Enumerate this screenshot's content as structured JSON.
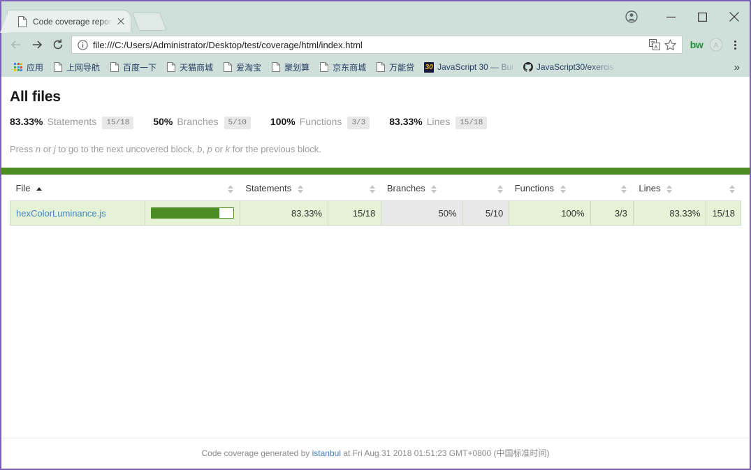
{
  "browser": {
    "tab": {
      "title": "Code coverage report f",
      "favicon": "document-icon",
      "close_label": "×"
    },
    "new_tab_label": "+",
    "window_controls": {
      "profile": "account-icon",
      "minimize": "—",
      "maximize": "▢",
      "close": "✕"
    },
    "nav": {
      "back": "←",
      "forward": "→",
      "reload": "⟳"
    },
    "omnibox": {
      "url": "file:///C:/Users/Administrator/Desktop/test/coverage/html/index.html",
      "info_icon": "info-circle-icon",
      "translate_icon": "translate-icon",
      "bookmark_icon": "star-icon"
    },
    "extensions": [
      {
        "name": "bw-extension",
        "label": "bw"
      },
      {
        "name": "angular-extension",
        "label": "A"
      }
    ],
    "menu_label": "⋮",
    "bookmarks": [
      {
        "name": "apps",
        "label": "应用",
        "icon": "apps-grid-icon"
      },
      {
        "name": "shangwang-daohang",
        "label": "上网导航",
        "icon": "page-icon"
      },
      {
        "name": "baidu",
        "label": "百度一下",
        "icon": "page-icon"
      },
      {
        "name": "tmall",
        "label": "天猫商城",
        "icon": "page-icon"
      },
      {
        "name": "aitaobao",
        "label": "爱淘宝",
        "icon": "page-icon"
      },
      {
        "name": "juhuasuan",
        "label": "聚划算",
        "icon": "page-icon"
      },
      {
        "name": "jingdong",
        "label": "京东商城",
        "icon": "page-icon"
      },
      {
        "name": "wannengdai",
        "label": "万能贷",
        "icon": "page-icon"
      },
      {
        "name": "javascript30",
        "label": "JavaScript 30 — Bui",
        "icon": "badge-30-icon"
      },
      {
        "name": "javascript30-github",
        "label": "JavaScript30/exercis",
        "icon": "github-icon"
      }
    ],
    "bookmarks_overflow": "»"
  },
  "report": {
    "title": "All files",
    "summary": [
      {
        "pct": "83.33%",
        "metric": "Statements",
        "fraction": "15/18"
      },
      {
        "pct": "50%",
        "metric": "Branches",
        "fraction": "5/10"
      },
      {
        "pct": "100%",
        "metric": "Functions",
        "fraction": "3/3"
      },
      {
        "pct": "83.33%",
        "metric": "Lines",
        "fraction": "15/18"
      }
    ],
    "hint": {
      "p1": "Press ",
      "k1": "n",
      "p2": " or ",
      "k2": "j",
      "p3": " to go to the next uncovered block, ",
      "k3": "b",
      "p4": ", ",
      "k4": "p",
      "p5": " or ",
      "k5": "k",
      "p6": " for the previous block."
    },
    "table": {
      "headers": {
        "file": "File",
        "statements": "Statements",
        "branches": "Branches",
        "functions": "Functions",
        "lines": "Lines"
      },
      "sort": {
        "column": "File",
        "direction": "asc"
      },
      "rows": [
        {
          "file": "hexColorLuminance.js",
          "bar_pct": 83.33,
          "statements_pct": "83.33%",
          "statements_frac": "15/18",
          "statements_level": "high",
          "branches_pct": "50%",
          "branches_frac": "5/10",
          "branches_level": "medium",
          "functions_pct": "100%",
          "functions_frac": "3/3",
          "functions_level": "high",
          "lines_pct": "83.33%",
          "lines_frac": "15/18",
          "lines_level": "high"
        }
      ]
    },
    "footer": {
      "prefix": "Code coverage generated by ",
      "link": "istanbul",
      "suffix": " at Fri Aug 31 2018 01:51:23 GMT+0800 (中国标准时间)"
    }
  },
  "colors": {
    "coverage_green": "#4c8c24",
    "row_high_bg": "#e6f2d6",
    "row_medium_bg": "#e8e8e8",
    "link_blue": "#4183c4",
    "window_border": "#7a5fb5"
  }
}
